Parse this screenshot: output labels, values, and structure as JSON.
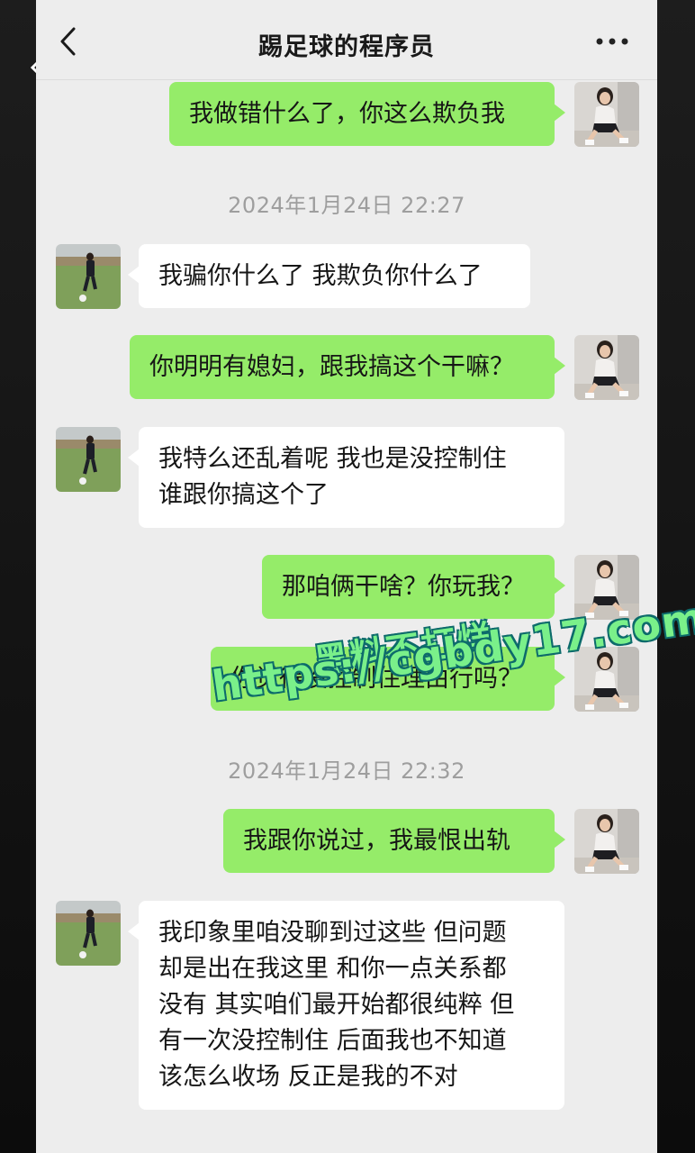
{
  "header": {
    "title": "踢足球的程序员",
    "more_label": "•••"
  },
  "timestamps": [
    "2024年1月24日 22:27",
    "2024年1月24日 22:32"
  ],
  "messages": [
    {
      "side": "me",
      "text": "我做错什么了，你这么欺负我"
    },
    {
      "side": "other",
      "text": "我骗你什么了 我欺负你什么了"
    },
    {
      "side": "me",
      "text": "你明明有媳妇，跟我搞这个干嘛？"
    },
    {
      "side": "other",
      "text": "我特么还乱着呢 我也是没控制住\n谁跟你搞这个了"
    },
    {
      "side": "me",
      "text": "那咱俩干啥？你玩我？"
    },
    {
      "side": "me",
      "text": "你觉得没控制住理由行吗？"
    },
    {
      "side": "me",
      "text": "我跟你说过，我最恨出轨"
    },
    {
      "side": "other",
      "text": "我印象里咱没聊到过这些 但问题\n却是出在我这里 和你一点关系都\n没有 其实咱们最开始都很纯粹 但\n有一次没控制住 后面我也不知道\n该怎么收场 反正是我的不对"
    }
  ],
  "watermark": {
    "line1": "黑料不打烊",
    "line2": "https://cgbdy17.com"
  },
  "colors": {
    "me_bubble": "#95ec69",
    "other_bubble": "#ffffff",
    "chat_bg": "#ededed"
  },
  "icons": {
    "back": "chevron-left-icon",
    "more": "more-dots-icon",
    "outer_back": "chevron-left-icon"
  }
}
